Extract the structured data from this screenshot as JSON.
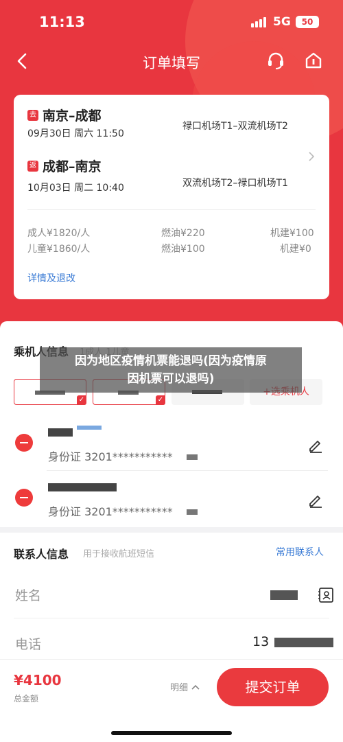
{
  "status_bar": {
    "time": "11:13",
    "network": "5G",
    "battery": "50"
  },
  "nav": {
    "title": "订单填写"
  },
  "flight": {
    "segments": [
      {
        "tag": "去",
        "route": "南京–成都",
        "datetime": "09月30日 周六 11:50",
        "airports": "禄口机场T1–双流机场T2"
      },
      {
        "tag": "返",
        "route": "成都–南京",
        "datetime": "10月03日 周二 10:40",
        "airports": "双流机场T2–禄口机场T1"
      }
    ],
    "prices": {
      "adult_fare": "成人¥1820/人",
      "adult_fuel": "燃油¥220",
      "adult_tax": "机建¥100",
      "child_fare": "儿童¥1860/人",
      "child_fuel": "燃油¥100",
      "child_tax": "机建¥0"
    },
    "details_link": "详情及退改"
  },
  "passengers": {
    "title": "乘机人信息",
    "subtitle": "1成人 1儿童",
    "add_label": "+选乘机人",
    "rows": [
      {
        "id_text": "身份证 3201***********"
      },
      {
        "id_text": "身份证 3201***********"
      }
    ]
  },
  "contact": {
    "title": "联系人信息",
    "hint": "用于接收航班短信",
    "frequent": "常用联系人",
    "name_label": "姓名",
    "phone_label": "电话",
    "phone_prefix": "13"
  },
  "bottom": {
    "total": "¥4100",
    "total_label": "总金额",
    "detail_label": "明细",
    "submit_label": "提交订单"
  },
  "watermark": {
    "line1": "因为地区疫情机票能退吗(因为疫情原",
    "line2": "因机票可以退吗)"
  },
  "colors": {
    "brand_red": "#e8363f",
    "link_blue": "#3a7bd5"
  }
}
